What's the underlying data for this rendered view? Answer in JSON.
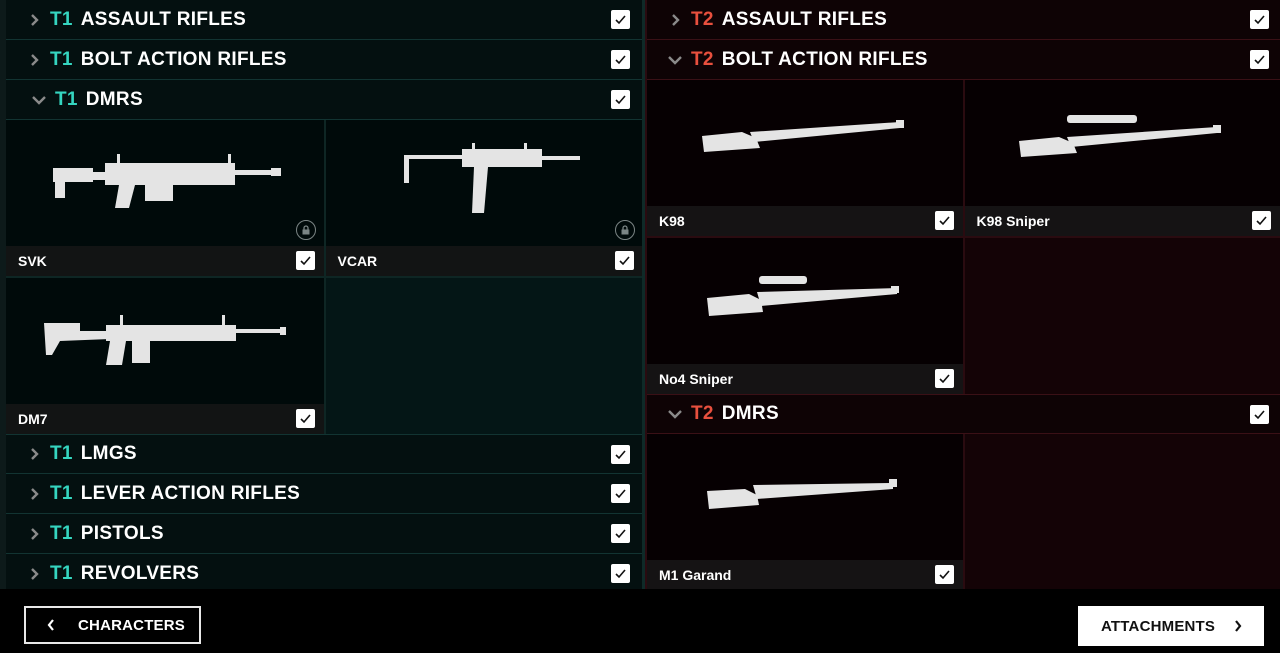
{
  "colors": {
    "t1_accent": "#35d5c0",
    "t2_accent": "#e8503e"
  },
  "left": {
    "categories": [
      {
        "tier": "T1",
        "name": "ASSAULT RIFLES",
        "expanded": false,
        "checked": true
      },
      {
        "tier": "T1",
        "name": "BOLT ACTION RIFLES",
        "expanded": false,
        "checked": true
      },
      {
        "tier": "T1",
        "name": "DMRS",
        "expanded": true,
        "checked": true,
        "weapons": [
          {
            "name": "SVK",
            "checked": true,
            "locked": true,
            "icon": "rifle-svk-icon"
          },
          {
            "name": "VCAR",
            "checked": true,
            "locked": true,
            "icon": "smg-vcar-icon"
          },
          {
            "name": "DM7",
            "checked": true,
            "locked": false,
            "icon": "rifle-dm7-icon"
          }
        ]
      },
      {
        "tier": "T1",
        "name": "LMGS",
        "expanded": false,
        "checked": true
      },
      {
        "tier": "T1",
        "name": "LEVER ACTION RIFLES",
        "expanded": false,
        "checked": true
      },
      {
        "tier": "T1",
        "name": "PISTOLS",
        "expanded": false,
        "checked": true
      },
      {
        "tier": "T1",
        "name": "REVOLVERS",
        "expanded": false,
        "checked": true
      }
    ]
  },
  "right": {
    "categories": [
      {
        "tier": "T2",
        "name": "ASSAULT RIFLES",
        "expanded": false,
        "checked": true
      },
      {
        "tier": "T2",
        "name": "BOLT ACTION RIFLES",
        "expanded": true,
        "checked": true,
        "weapons": [
          {
            "name": "K98",
            "checked": true,
            "icon": "rifle-k98-icon"
          },
          {
            "name": "K98 Sniper",
            "checked": true,
            "icon": "rifle-k98-sniper-icon"
          },
          {
            "name": "No4 Sniper",
            "checked": true,
            "icon": "rifle-no4-sniper-icon"
          }
        ]
      },
      {
        "tier": "T2",
        "name": "DMRS",
        "expanded": true,
        "checked": true,
        "weapons": [
          {
            "name": "M1 Garand",
            "checked": true,
            "icon": "rifle-m1-garand-icon"
          }
        ]
      }
    ]
  },
  "footer": {
    "back_label": "CHARACTERS",
    "next_label": "ATTACHMENTS"
  }
}
